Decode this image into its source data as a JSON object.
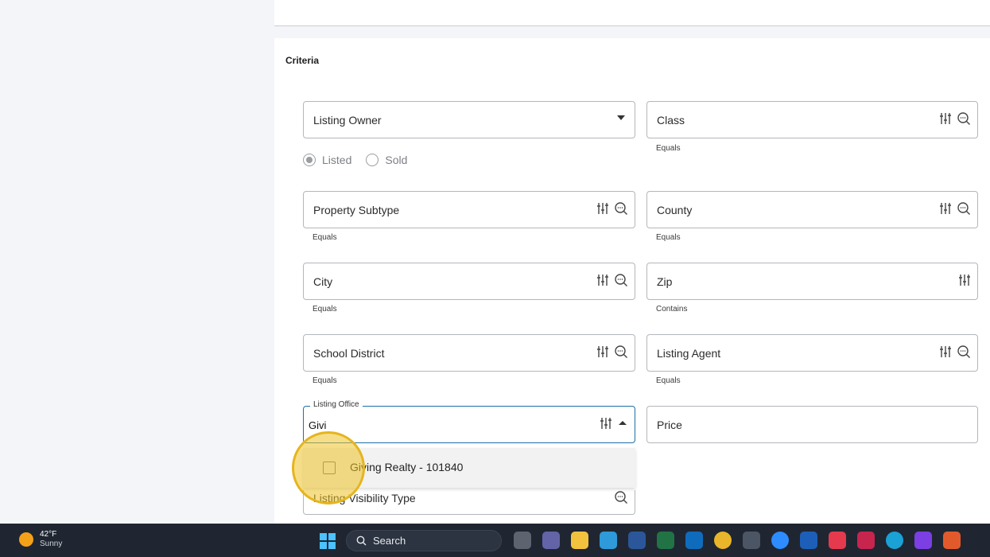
{
  "form": {
    "section_title": "Criteria",
    "fields": {
      "listing_owner": {
        "label": "Listing Owner"
      },
      "class": {
        "label": "Class",
        "hint": "Equals"
      },
      "property_subtype": {
        "label": "Property Subtype",
        "hint": "Equals"
      },
      "county": {
        "label": "County",
        "hint": "Equals"
      },
      "city": {
        "label": "City",
        "hint": "Equals"
      },
      "zip": {
        "label": "Zip",
        "hint": "Contains"
      },
      "school_district": {
        "label": "School District",
        "hint": "Equals"
      },
      "listing_agent": {
        "label": "Listing Agent",
        "hint": "Equals"
      },
      "listing_office": {
        "legend": "Listing Office",
        "value": "Givi"
      },
      "price": {
        "label": "Price"
      },
      "listing_visibility_type": {
        "label": "Listing Visibility Type"
      }
    },
    "radios": {
      "listed": "Listed",
      "sold": "Sold",
      "selected": "listed"
    },
    "dropdown": {
      "options": [
        {
          "label": "Giving Realty - 101840",
          "checked": false
        }
      ]
    }
  },
  "taskbar": {
    "weather": {
      "temp": "42°F",
      "condition": "Sunny"
    },
    "search_label": "Search",
    "apps": [
      "task-view",
      "teams",
      "file-explorer",
      "edge",
      "word",
      "excel",
      "outlook",
      "chrome",
      "calculator",
      "zoom",
      "app-r",
      "app-red",
      "app-pink",
      "canva",
      "onenote",
      "app-orange"
    ]
  },
  "colors": {
    "accent": "#1d6fa5",
    "highlight": "#eec328",
    "taskbar": "#1f2631"
  }
}
